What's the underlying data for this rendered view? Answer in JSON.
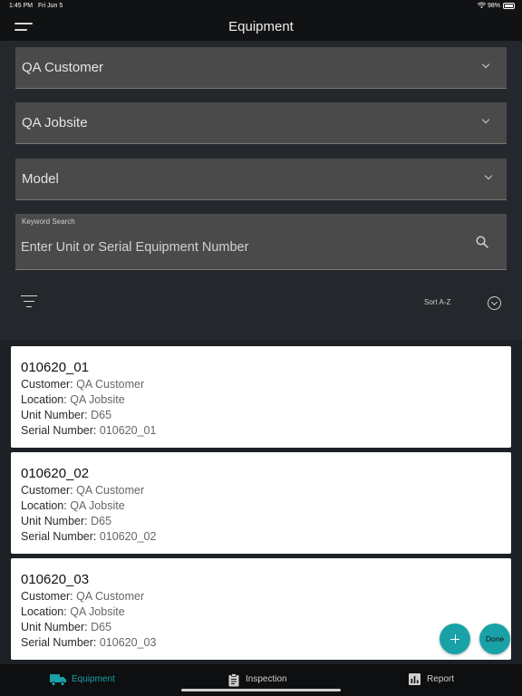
{
  "status_bar": {
    "time": "1:45 PM",
    "date": "Fri Jun 5",
    "battery": "98%"
  },
  "nav": {
    "title": "Equipment"
  },
  "filters": {
    "customer": "QA Customer",
    "jobsite": "QA Jobsite",
    "model": "Model",
    "keyword_label": "Keyword Search",
    "keyword_placeholder": "Enter Unit or Serial Equipment Number",
    "sort_label": "Sort A-Z"
  },
  "field_labels": {
    "customer": "Customer:",
    "location": "Location:",
    "unit": "Unit Number:",
    "serial": "Serial Number:"
  },
  "equipment": [
    {
      "name": "010620_01",
      "customer": "QA Customer",
      "location": "QA Jobsite",
      "unit": "D65",
      "serial": "010620_01"
    },
    {
      "name": "010620_02",
      "customer": "QA Customer",
      "location": "QA Jobsite",
      "unit": "D65",
      "serial": "010620_02"
    },
    {
      "name": "010620_03",
      "customer": "QA Customer",
      "location": "QA Jobsite",
      "unit": "D65",
      "serial": "010620_03"
    }
  ],
  "actions": {
    "done_label": "Done"
  },
  "tabs": [
    {
      "label": "Equipment",
      "icon": "truck-icon",
      "active": true
    },
    {
      "label": "Inspection",
      "icon": "clipboard-icon",
      "active": false
    },
    {
      "label": "Report",
      "icon": "bar-chart-icon",
      "active": false
    }
  ],
  "colors": {
    "accent": "#18a2a7",
    "background": "#24272c",
    "field": "#4a4a4a"
  }
}
